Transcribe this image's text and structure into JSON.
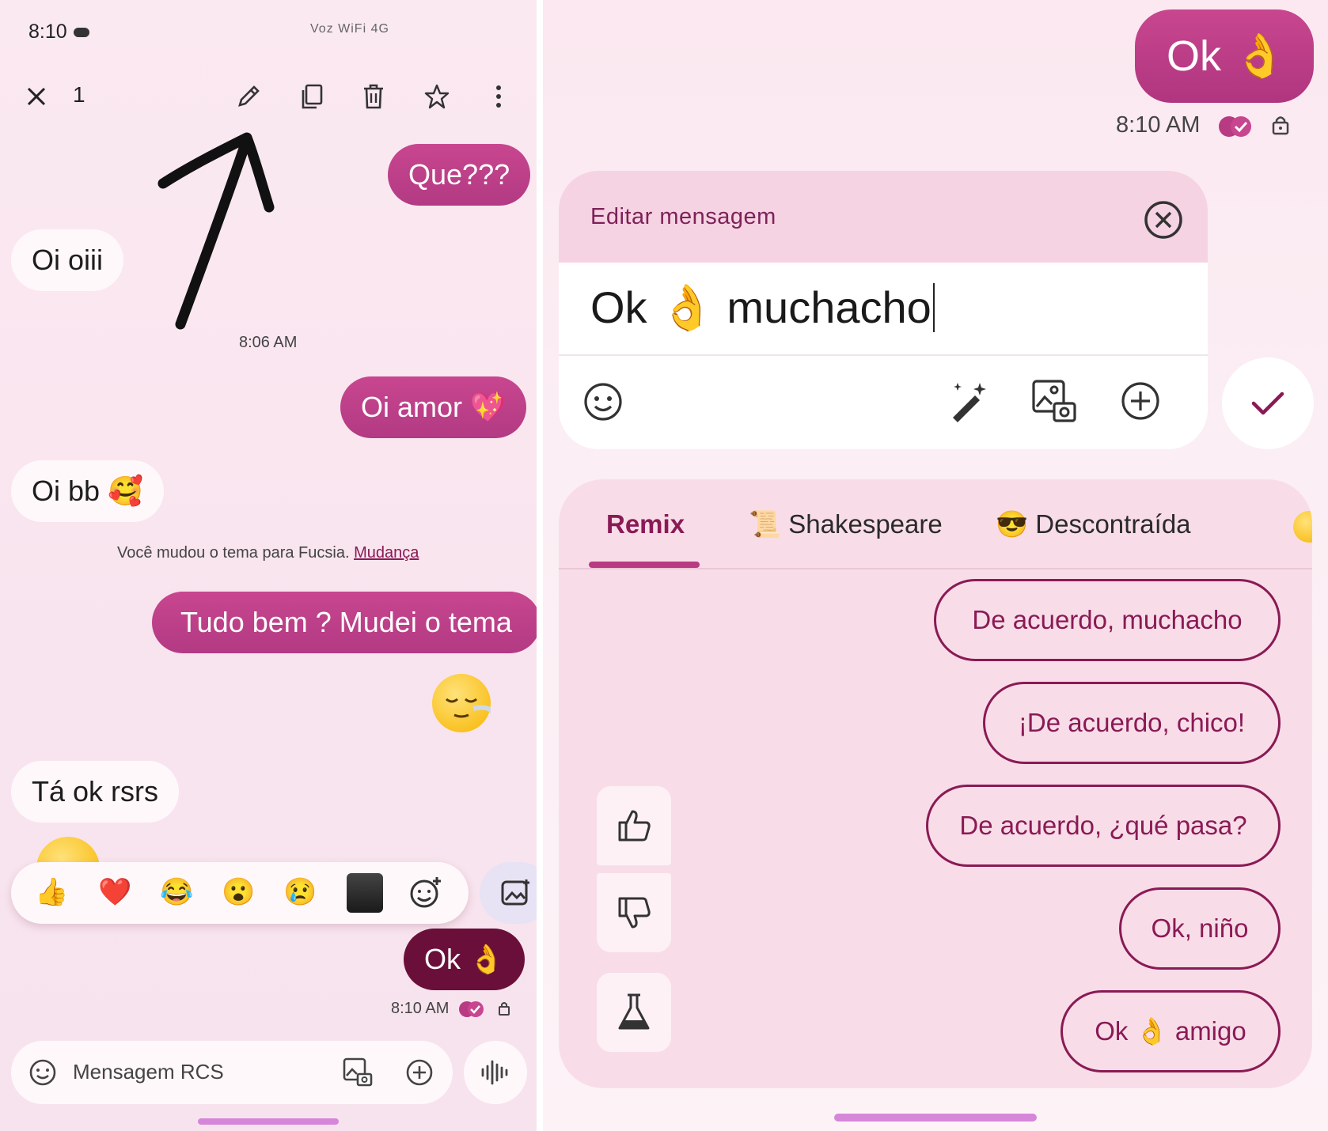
{
  "left": {
    "status_time": "8:10",
    "status_icons_text": "Voz WiFi 4G",
    "selection_count": "1",
    "messages": {
      "que": "Que???",
      "oi_oiii": "Oi oiii",
      "time_806": "8:06 AM",
      "oi_amor": "Oi amor 💖",
      "oi_bb": "Oi bb 🥰",
      "theme_notice": "Você mudou o tema para Fucsia.",
      "theme_link": "Mudança",
      "tudo_bem": "Tudo bem ? Mudei o tema",
      "ta_ok": "Tá ok rsrs",
      "ok": "Ok 👌",
      "time_810": "8:10 AM"
    },
    "reactions": [
      "👍",
      "❤️",
      "😂",
      "😮",
      "😢"
    ],
    "composer_placeholder": "Mensagem RCS"
  },
  "right": {
    "ok_message": "Ok 👌",
    "ok_time": "8:10 AM",
    "edit_title": "Editar mensagem",
    "edit_text": "Ok 👌 muchacho",
    "tabs": {
      "remix": "Remix",
      "shakespeare": "📜 Shakespeare",
      "descontraida": "😎 Descontraída"
    },
    "suggestions": {
      "s1": "De acuerdo, muchacho",
      "s2": "¡De acuerdo, chico!",
      "s3": "De acuerdo, ¿qué pasa?",
      "s4": "Ok, niño",
      "s5": "Ok 👌 amigo"
    }
  },
  "colors": {
    "accent": "#b83a82",
    "accent_dark": "#6a0f3a",
    "chip_text": "#8a1a55",
    "background": "#fbeef4"
  }
}
